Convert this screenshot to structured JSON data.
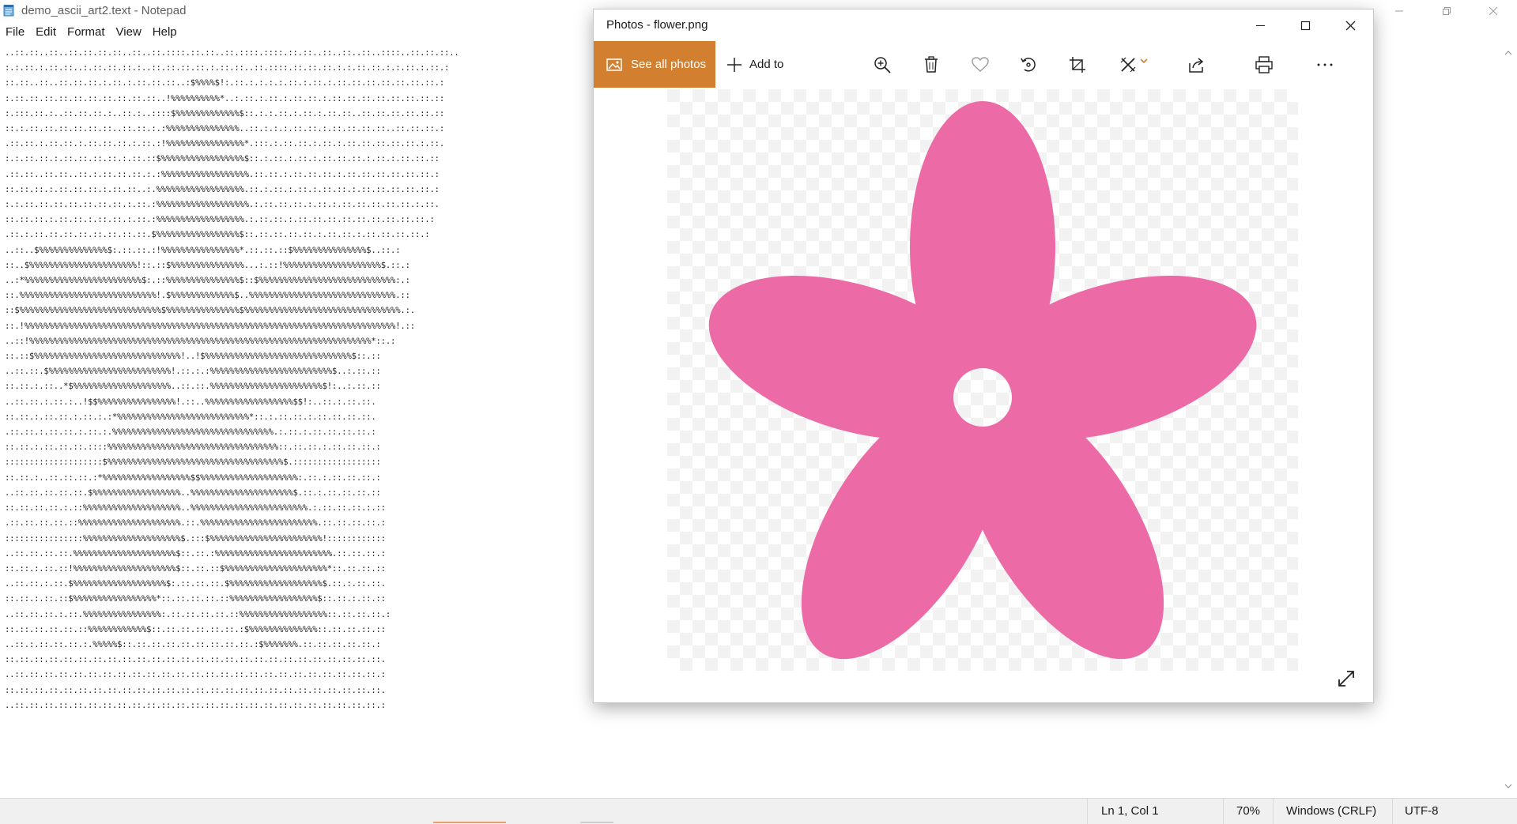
{
  "notepad": {
    "title": "demo_ascii_art2.text - Notepad",
    "menu": [
      "File",
      "Edit",
      "Format",
      "View",
      "Help"
    ],
    "lines": [
      "..::.::..::..::.::.::.::..::..::.::::.::.::..::.::::.::::.::.::..::..::..::..::::..::.::.::..",
      ":.:.::.:.::.::..:.::.::.::.:..::.::.::.::.:.::.::..::.::::.::.::.::.:.:.::.::.:.:.::.:.::.:",
      "::.::..::..::.::.::.:.::.:.::.::.::..:$%%%%$!:.::.:.:.:.:.::.:.::.:.::.::.::.::.::.::.::.:",
      ":.::.::.::.::.::.::.::.::.::.::..!%%%%%%%%%%*..:.::.:.::.:.::.::.:.::.::.::.::.::.::.::.::",
      ":.:::.::.:..::.::.::.:..::.:..::::$%%%%%%%%%%%%%$::.:.:.::.:.::.:.::.::..::.::.::.::.::.::",
      "::.:.::.::.::.::.::.::..::.::.:.:%%%%%%%%%%%%%%%..::.:.:.:.::.::.:.::.::.::.::..::.::.::.:",
      ".::.::.:.::.::.:.::.::.::.:.::.:!%%%%%%%%%%%%%%%%*.:::.:.::.::.:.::.:.::.::.::.::.::.:.::.",
      ":.:.::.::.:.::.::.::.::.:.::.::$%%%%%%%%%%%%%%%%%$::.:.::.:.::.:.::.::.::.:.::.:.::.::.::",
      ".::.::..::.::..::.:.::.::.::.:.:%%%%%%%%%%%%%%%%%%.::.::.:.::.::.::.:.::.::.::.::.::.::.:",
      "::.::.::.:.::.::.::.:.::.::..:.%%%%%%%%%%%%%%%%%%.::.:.::.:.::.:.::.::.:.::.::.::.::.::.:",
      ":.:.::.::.::.::.::.::.::.:.::.:%%%%%%%%%%%%%%%%%%%.:.::.::.::.:.::.:.::.::.::.::.::.:.::.",
      "::.::.::.:.::.::.:.::.::.:.::.:%%%%%%%%%%%%%%%%%%.:.::.::.:.::.::.::.::.::.::.::.::.::.:",
      ".::.:.::.::.::.::.::.::.::.::.$%%%%%%%%%%%%%%%%%$::.::.::.::.::.:.::.::.:.::.::.::.::.:",
      "..::..$%%%%%%%%%%%%%%$:.::.::.:!%%%%%%%%%%%%%%%%*.::.::.::$%%%%%%%%%%%%%%%$..::.:",
      "::..$%%%%%%%%%%%%%%%%%%%%%%!::.::$%%%%%%%%%%%%%%%...:.::!%%%%%%%%%%%%%%%%%%%%$.::.:",
      "..:*%%%%%%%%%%%%%%%%%%%%%%%%$:.::%%%%%%%%%%%%%%%$::$%%%%%%%%%%%%%%%%%%%%%%%%%%%%:.:",
      "::.%%%%%%%%%%%%%%%%%%%%%%%%%%%%!.$%%%%%%%%%%%%%$..%%%%%%%%%%%%%%%%%%%%%%%%%%%%%%.::",
      "::$%%%%%%%%%%%%%%%%%%%%%%%%%%%%%$%%%%%%%%%%%%%%%$%%%%%%%%%%%%%%%%%%%%%%%%%%%%%%%%.:.",
      "::.!%%%%%%%%%%%%%%%%%%%%%%%%%%%%%%%%%%%%%%%%%%%%%%%%%%%%%%%%%%%%%%%%%%%%%%%%%%%%!.::",
      "..::!%%%%%%%%%%%%%%%%%%%%%%%%%%%%%%%%%%%%%%%%%%%%%%%%%%%%%%%%%%%%%%%%%%%%%%*::.:",
      "::.::$%%%%%%%%%%%%%%%%%%%%%%%%%%%%%%!..!$%%%%%%%%%%%%%%%%%%%%%%%%%%%%%%$::.::",
      "..::.::.$%%%%%%%%%%%%%%%%%%%%%%%%%!.::.:.:%%%%%%%%%%%%%%%%%%%%%%%%%$..:.::.::",
      "::.::.:.::..*$%%%%%%%%%%%%%%%%%%%%..::.::.%%%%%%%%%%%%%%%%%%%%%%%$!:..:.::.::",
      "..::.::.:.::.:..!$$%%%%%%%%%%%%%%%%!.::..%%%%%%%%%%%%%%%%%%$$!:..::.:.::.::.",
      "::.::.:.::.::.:.::.:.:*%%%%%%%%%%%%%%%%%%%%%%%%%%%*::.:.::.::.:.::.::.::.::.",
      ".::.::.:.::.::.:.::.:.%%%%%%%%%%%%%%%%%%%%%%%%%%%%%%%%%.:.::.:.::.::.::.::.:",
      "::.::.:.::.::.::.::::%%%%%%%%%%%%%%%%%%%%%%%%%%%%%%%%%%%::.::.::.:.::.::.::.:",
      "::::::::::::::::::::$%%%%%%%%%%%%%%%%%%%%%%%%%%%%%%%%%%%%$.::::::::::::::::::",
      "::.::.:..::.::.::.:*%%%%%%%%%%%%%%%%%%$$%%%%%%%%%%%%%%%%%%%%:.::.:.::.::.::.:",
      "..::.::.::.::.::.$%%%%%%%%%%%%%%%%%%..%%%%%%%%%%%%%%%%%%%%%$.::.:.::.::.::.::",
      "::.::.::.::.:.::%%%%%%%%%%%%%%%%%%%%..%%%%%%%%%%%%%%%%%%%%%%%%.:.::.::.::.:.::",
      ".::.::.::.::.::%%%%%%%%%%%%%%%%%%%%%.::.%%%%%%%%%%%%%%%%%%%%%%%%.::.::.::.::.:",
      "::::::::::::::::%%%%%%%%%%%%%%%%%%%%$.:::$%%%%%%%%%%%%%%%%%%%%%%%!::::::::::::",
      "..::.::.::.::.%%%%%%%%%%%%%%%%%%%%%$::.::.:%%%%%%%%%%%%%%%%%%%%%%%%.::.::.::.:",
      "::.::.:.::.::!%%%%%%%%%%%%%%%%%%%%%$::.::.::$%%%%%%%%%%%%%%%%%%%%%*::.::.::.::",
      "..::.::.:.::.$%%%%%%%%%%%%%%%%%%%$:.::.::.::.$%%%%%%%%%%%%%%%%%%%$.::.:.::.::.",
      "::.::.:.::.::$%%%%%%%%%%%%%%%%%*::.::.::.::.::%%%%%%%%%%%%%%%%%%$::.::.:.::.::",
      "..::.::.::.:.::.%%%%%%%%%%%%%%%%:.::.::.::.::.::%%%%%%%%%%%%%%%%%%::.::.::.::.:",
      "::.::.::.::.::.::%%%%%%%%%%%%$::.::.::.::.::.::.:$%%%%%%%%%%%%%%::.::.::.::.::",
      "..::.:.::.::.::.:.%%%%%$::.::.::.::.::.::.::.::.::.:$%%%%%%%.::.::.::.::.::.:",
      "::.::.::.::.::.::.::.::.::.::.::.::.::.::.::.::.::.::.::.::.::.::.::.::.::.::.",
      "..::.::.::.::.::.::.::.::.::.::.::.::.::.::.::.::.::.::.::.::.::.::.::.::.::.:",
      "::.::.::.::.::.::.::.::.::.::.::.::.::.::.::.::.::.::.::.::.::.::.::.::.::.::.",
      "..::.::.::.::.::.::.::.::.::.::.::.::.::.::.::.::.::.::.::.::.::.::.::.::.::.:"
    ],
    "status": {
      "position": "Ln 1, Col 1",
      "zoom": "70%",
      "line_ending": "Windows (CRLF)",
      "encoding": "UTF-8"
    }
  },
  "photos": {
    "title": "Photos - flower.png",
    "see_all_label": "See all photos",
    "add_to_label": "Add to",
    "accent_color": "#d2802f",
    "flower_color": "#ec6ba7",
    "tools": [
      "zoom-in-icon",
      "delete-icon",
      "favorite-icon",
      "rotate-icon",
      "crop-icon",
      "edit-icon",
      "share-icon",
      "print-icon",
      "more-icon"
    ]
  }
}
